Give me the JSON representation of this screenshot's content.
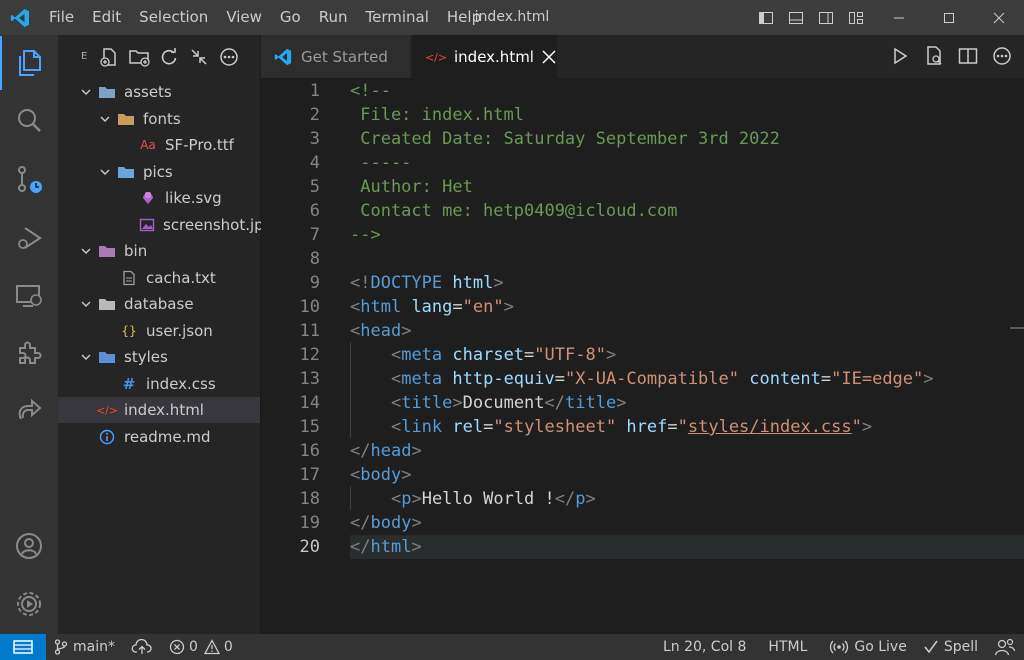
{
  "window": {
    "title": "index.html",
    "menu": [
      "File",
      "Edit",
      "Selection",
      "View",
      "Go",
      "Run",
      "Terminal",
      "Help"
    ]
  },
  "activity_bar": {
    "items": [
      "explorer-icon",
      "search-icon",
      "source-control-icon",
      "run-debug-icon",
      "remote-explorer-icon",
      "extensions-icon",
      "live-share-icon",
      "account-icon",
      "settings-gear-icon"
    ]
  },
  "explorer": {
    "header_short": "E",
    "tree": [
      {
        "label": "assets",
        "type": "folder",
        "depth": 0,
        "open": true
      },
      {
        "label": "fonts",
        "type": "folder",
        "depth": 1,
        "open": true
      },
      {
        "label": "SF-Pro.ttf",
        "type": "font",
        "depth": 2,
        "icon_text": "Aa"
      },
      {
        "label": "pics",
        "type": "folder",
        "depth": 1,
        "open": true
      },
      {
        "label": "like.svg",
        "type": "svg",
        "depth": 2
      },
      {
        "label": "screenshot.jpeg",
        "type": "image",
        "depth": 2
      },
      {
        "label": "bin",
        "type": "folder",
        "depth": 0,
        "open": true
      },
      {
        "label": "cacha.txt",
        "type": "text",
        "depth": 1
      },
      {
        "label": "database",
        "type": "folder",
        "depth": 0,
        "open": true
      },
      {
        "label": "user.json",
        "type": "json",
        "depth": 1,
        "icon_text": "{}"
      },
      {
        "label": "styles",
        "type": "folder",
        "depth": 0,
        "open": true
      },
      {
        "label": "index.css",
        "type": "css",
        "depth": 1,
        "icon_text": "#"
      },
      {
        "label": "index.html",
        "type": "html",
        "depth": 0,
        "selected": true,
        "icon_text": "</>"
      },
      {
        "label": "readme.md",
        "type": "info",
        "depth": 0,
        "icon_text": "i"
      }
    ]
  },
  "tabs": [
    {
      "label": "Get Started",
      "active": false
    },
    {
      "label": "index.html",
      "active": true
    }
  ],
  "editor": {
    "current_line": 20,
    "lines": [
      [
        {
          "t": "<!--",
          "c": "com"
        }
      ],
      [
        {
          "t": " File: index.html",
          "c": "com"
        }
      ],
      [
        {
          "t": " Created Date: Saturday September 3rd 2022",
          "c": "com"
        }
      ],
      [
        {
          "t": " -----",
          "c": "com"
        }
      ],
      [
        {
          "t": " Author: Het",
          "c": "com"
        }
      ],
      [
        {
          "t": " Contact me: hetp0409@icloud.com",
          "c": "com"
        }
      ],
      [
        {
          "t": "-->",
          "c": "com"
        }
      ],
      [],
      [
        {
          "t": "<!",
          "c": "ang"
        },
        {
          "t": "DOCTYPE",
          "c": "tag"
        },
        {
          "t": " html",
          "c": "attr"
        },
        {
          "t": ">",
          "c": "ang"
        }
      ],
      [
        {
          "t": "<",
          "c": "ang"
        },
        {
          "t": "html",
          "c": "tag"
        },
        {
          "t": " lang",
          "c": "attr"
        },
        {
          "t": "=",
          "c": "eq"
        },
        {
          "t": "\"en\"",
          "c": "str"
        },
        {
          "t": ">",
          "c": "ang"
        }
      ],
      [
        {
          "t": "<",
          "c": "ang"
        },
        {
          "t": "head",
          "c": "tag"
        },
        {
          "t": ">",
          "c": "ang"
        }
      ],
      [
        {
          "t": "    ",
          "c": "txt"
        },
        {
          "t": "<",
          "c": "ang"
        },
        {
          "t": "meta",
          "c": "tag"
        },
        {
          "t": " charset",
          "c": "attr"
        },
        {
          "t": "=",
          "c": "eq"
        },
        {
          "t": "\"UTF-8\"",
          "c": "str"
        },
        {
          "t": ">",
          "c": "ang"
        }
      ],
      [
        {
          "t": "    ",
          "c": "txt"
        },
        {
          "t": "<",
          "c": "ang"
        },
        {
          "t": "meta",
          "c": "tag"
        },
        {
          "t": " http-equiv",
          "c": "attr"
        },
        {
          "t": "=",
          "c": "eq"
        },
        {
          "t": "\"X-UA-Compatible\"",
          "c": "str"
        },
        {
          "t": " content",
          "c": "attr"
        },
        {
          "t": "=",
          "c": "eq"
        },
        {
          "t": "\"IE=edge\"",
          "c": "str"
        },
        {
          "t": ">",
          "c": "ang"
        }
      ],
      [
        {
          "t": "    ",
          "c": "txt"
        },
        {
          "t": "<",
          "c": "ang"
        },
        {
          "t": "title",
          "c": "tag"
        },
        {
          "t": ">",
          "c": "ang"
        },
        {
          "t": "Document",
          "c": "txt"
        },
        {
          "t": "</",
          "c": "ang"
        },
        {
          "t": "title",
          "c": "tag"
        },
        {
          "t": ">",
          "c": "ang"
        }
      ],
      [
        {
          "t": "    ",
          "c": "txt"
        },
        {
          "t": "<",
          "c": "ang"
        },
        {
          "t": "link",
          "c": "tag"
        },
        {
          "t": " rel",
          "c": "attr"
        },
        {
          "t": "=",
          "c": "eq"
        },
        {
          "t": "\"stylesheet\"",
          "c": "str"
        },
        {
          "t": " href",
          "c": "attr"
        },
        {
          "t": "=",
          "c": "eq"
        },
        {
          "t": "\"",
          "c": "str"
        },
        {
          "t": "styles/index.css",
          "c": "str",
          "u": true
        },
        {
          "t": "\"",
          "c": "str"
        },
        {
          "t": ">",
          "c": "ang"
        }
      ],
      [
        {
          "t": "</",
          "c": "ang"
        },
        {
          "t": "head",
          "c": "tag"
        },
        {
          "t": ">",
          "c": "ang"
        }
      ],
      [
        {
          "t": "<",
          "c": "ang"
        },
        {
          "t": "body",
          "c": "tag"
        },
        {
          "t": ">",
          "c": "ang"
        }
      ],
      [
        {
          "t": "    ",
          "c": "txt"
        },
        {
          "t": "<",
          "c": "ang"
        },
        {
          "t": "p",
          "c": "tag"
        },
        {
          "t": ">",
          "c": "ang"
        },
        {
          "t": "Hello World !",
          "c": "txt"
        },
        {
          "t": "</",
          "c": "ang"
        },
        {
          "t": "p",
          "c": "tag"
        },
        {
          "t": ">",
          "c": "ang"
        }
      ],
      [
        {
          "t": "</",
          "c": "ang"
        },
        {
          "t": "body",
          "c": "tag"
        },
        {
          "t": ">",
          "c": "ang"
        }
      ],
      [
        {
          "t": "</",
          "c": "ang"
        },
        {
          "t": "html",
          "c": "tag"
        },
        {
          "t": ">",
          "c": "ang"
        }
      ]
    ]
  },
  "status_bar": {
    "branch": "main*",
    "errors": "0",
    "warnings": "0",
    "position": "Ln 20, Col 8",
    "language": "HTML",
    "live": "Go Live",
    "spell": "Spell"
  },
  "colors": {
    "accent": "#007acc",
    "comment": "#6a9955",
    "tag": "#569cd6",
    "attribute": "#9cdcfe",
    "string": "#ce9178"
  }
}
